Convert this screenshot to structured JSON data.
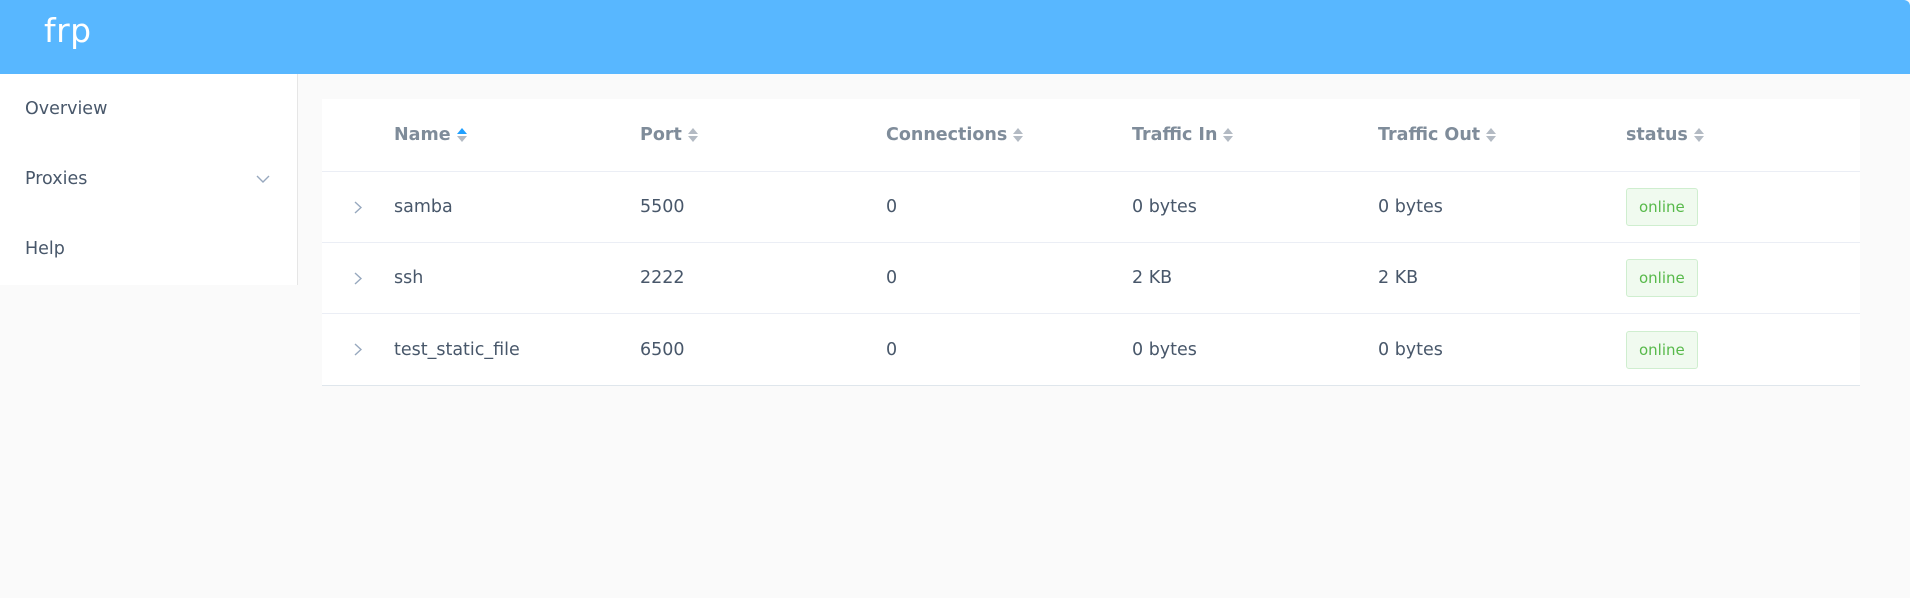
{
  "header": {
    "brand": "frp"
  },
  "sidebar": {
    "items": [
      {
        "label": "Overview"
      },
      {
        "label": "Proxies"
      },
      {
        "label": "Help"
      }
    ]
  },
  "table": {
    "columns": [
      "Name",
      "Port",
      "Connections",
      "Traffic In",
      "Traffic Out",
      "status"
    ],
    "rows": [
      {
        "name": "samba",
        "port": "5500",
        "connections": "0",
        "traffic_in": "0 bytes",
        "traffic_out": "0 bytes",
        "status": "online"
      },
      {
        "name": "ssh",
        "port": "2222",
        "connections": "0",
        "traffic_in": "2 KB",
        "traffic_out": "2 KB",
        "status": "online"
      },
      {
        "name": "test_static_file",
        "port": "6500",
        "connections": "0",
        "traffic_in": "0 bytes",
        "traffic_out": "0 bytes",
        "status": "online"
      }
    ]
  },
  "colors": {
    "header_bg": "#58b7ff",
    "sort_active": "#20a0ff",
    "status_online_text": "#57b94a",
    "status_online_bg": "#f0faef"
  }
}
